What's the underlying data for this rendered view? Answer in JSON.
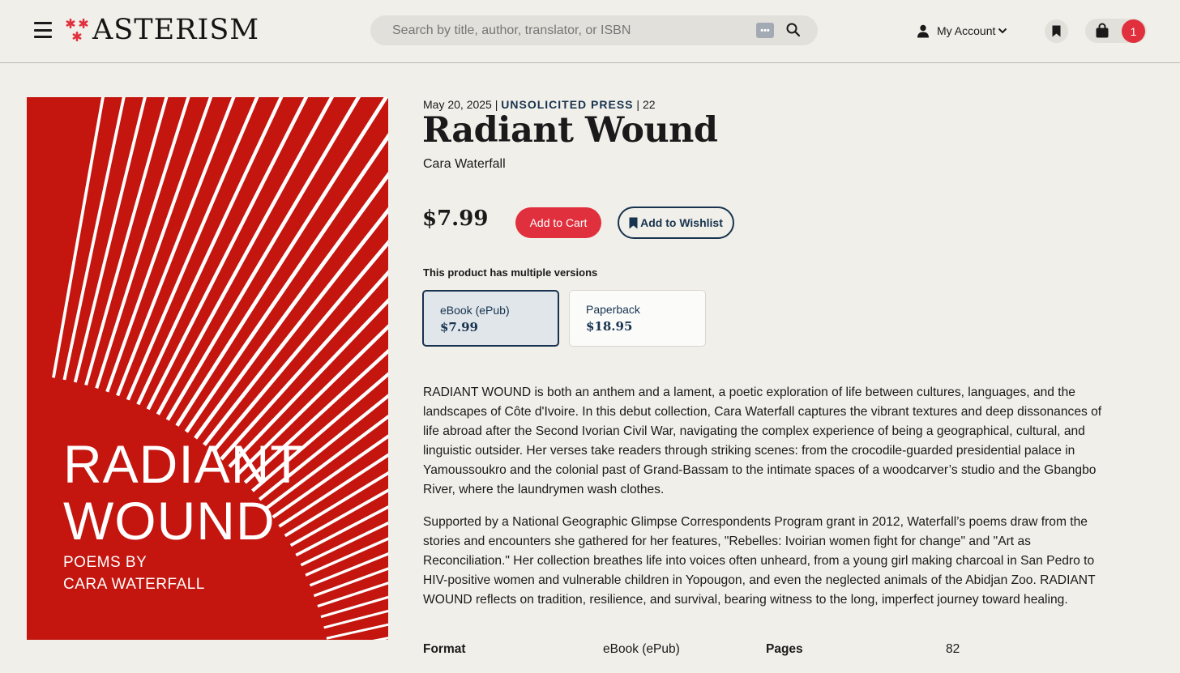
{
  "header": {
    "logo_text": "ASTERISM",
    "search_placeholder": "Search by title, author, translator, or ISBN",
    "account_label": "My Account",
    "cart_count": "1",
    "accent_color": "#e0303d",
    "icons": [
      "menu-icon",
      "asterisk-logo-icon",
      "password-manager-icon",
      "search-icon",
      "user-icon",
      "chevron-down-icon",
      "bookmark-icon",
      "shopping-bag-icon"
    ]
  },
  "cover": {
    "title_line1": "RADIANT",
    "title_line2": "WOUND",
    "sub_line1": "POEMS BY",
    "sub_line2": "CARA WATERFALL",
    "background_color": "#c4150f"
  },
  "product": {
    "date": "May 20, 2025",
    "sep1": "|",
    "press": "UNSOLICITED PRESS",
    "sep2": "|",
    "number": "22",
    "title": "Radiant Wound",
    "author": "Cara Waterfall",
    "price": "$7.99",
    "add_to_cart": "Add to Cart",
    "add_to_wishlist": "Add to Wishlist",
    "versions_label": "This product has multiple versions",
    "versions": [
      {
        "name": "eBook (ePub)",
        "price": "$7.99",
        "selected": true
      },
      {
        "name": "Paperback",
        "price": "$18.95",
        "selected": false
      }
    ],
    "description": [
      "RADIANT WOUND is both an anthem and a lament, a poetic exploration of life between cultures, languages, and the landscapes of Côte d'Ivoire. In this debut collection, Cara Waterfall captures the vibrant textures and deep dissonances of life abroad after the Second Ivorian Civil War, navigating the complex experience of being a geographical, cultural, and linguistic outsider. Her verses take readers through striking scenes: from the crocodile-guarded presidential palace in Yamoussoukro and the colonial past of Grand-Bassam to the intimate spaces of a woodcarver’s studio and the Gbangbo River, where the laundrymen wash clothes.",
      "Supported by a National Geographic Glimpse Correspondents Program grant in 2012, Waterfall’s poems draw from the stories and encounters she gathered for her features, \"Rebelles: Ivoirian women fight for change\" and \"Art as Reconciliation.\" Her collection breathes life into voices often unheard, from a young girl making charcoal in San Pedro to HIV-positive women and vulnerable children in Yopougon, and even the neglected animals of the Abidjan Zoo. RADIANT WOUND reflects on tradition, resilience, and survival, bearing witness to the long, imperfect journey toward healing."
    ],
    "specs": [
      {
        "key": "Format",
        "value": "eBook (ePub)"
      },
      {
        "key": "Pages",
        "value": "82"
      }
    ]
  }
}
